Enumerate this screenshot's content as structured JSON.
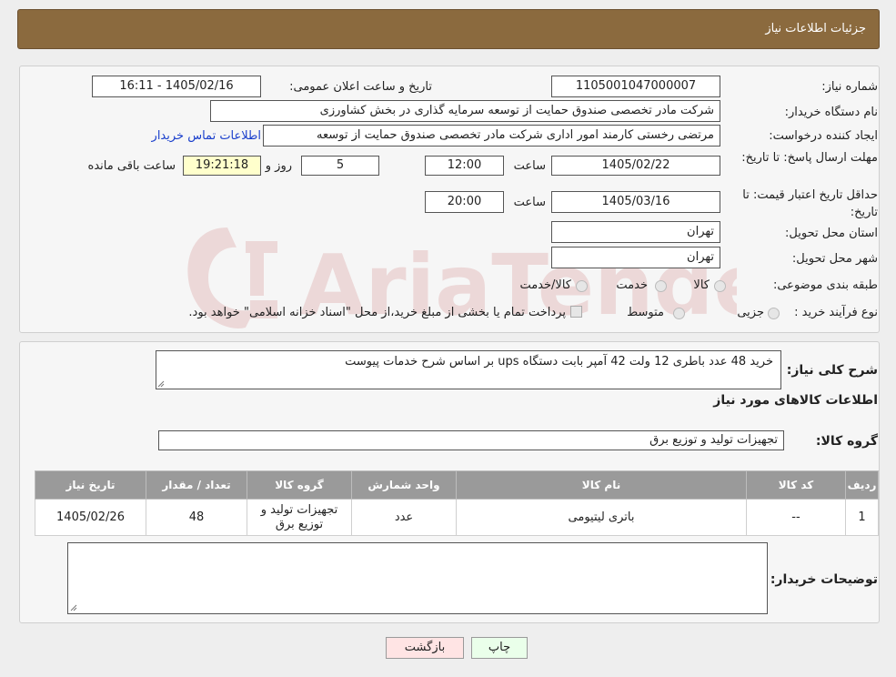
{
  "header": {
    "title": "جزئیات اطلاعات نیاز"
  },
  "form": {
    "need_number": {
      "label": "شماره نیاز:",
      "value": "1105001047000007"
    },
    "announce": {
      "label": "تاریخ و ساعت اعلان عمومی:",
      "value": "1405/02/16 - 16:11"
    },
    "buyer_org": {
      "label": "نام دستگاه خریدار:",
      "value": "شرکت مادر تخصصی صندوق حمایت از توسعه سرمایه گذاری در بخش کشاورزی"
    },
    "requester": {
      "label": "ایجاد کننده درخواست:",
      "value": "مرتضی رخستی کارمند امور اداری شرکت مادر تخصصی صندوق حمایت از توسعه",
      "link": "اطلاعات تماس خریدار"
    },
    "reply_deadline": {
      "label": "مهلت ارسال پاسخ: تا تاریخ:",
      "date": "1405/02/22",
      "time_label": "ساعت",
      "time": "12:00",
      "days": "5",
      "days_label": "روز و",
      "remaining": "19:21:18",
      "remaining_label": "ساعت باقی مانده"
    },
    "price_validity": {
      "label": "حداقل تاریخ اعتبار قیمت: تا تاریخ:",
      "date": "1405/03/16",
      "time_label": "ساعت",
      "time": "20:00"
    },
    "province": {
      "label": "استان محل تحویل:",
      "value": "تهران"
    },
    "city": {
      "label": "شهر محل تحویل:",
      "value": "تهران"
    },
    "category": {
      "label": "طبقه بندی موضوعی:",
      "options": [
        "کالا",
        "خدمت",
        "کالا/خدمت"
      ]
    },
    "process": {
      "label": "نوع فرآیند خرید :",
      "options": [
        "جزیی",
        "متوسط"
      ],
      "note": "پرداخت تمام یا بخشی از مبلغ خرید،از محل \"اسناد خزانه اسلامی\" خواهد بود."
    }
  },
  "summary": {
    "label": "شرح کلی نیاز:",
    "value": "خرید 48 عدد باطری 12 ولت 42 آمپر بابت دستگاه ups بر اساس شرح خدمات پیوست"
  },
  "goods_info_title": "اطلاعات کالاهای مورد نیاز",
  "goods_group": {
    "label": "گروه کالا:",
    "value": "تجهیزات تولید و توزیع برق"
  },
  "table": {
    "headers": [
      "ردیف",
      "کد کالا",
      "نام کالا",
      "واحد شمارش",
      "گروه کالا",
      "تعداد / مقدار",
      "تاریخ نیاز"
    ],
    "rows": [
      [
        "1",
        "--",
        "باتری لیتیومی",
        "عدد",
        "تجهیزات تولید و توزیع برق",
        "48",
        "1405/02/26"
      ]
    ]
  },
  "buyer_notes": {
    "label": "توضیحات خریدار:",
    "value": ""
  },
  "buttons": {
    "print": "چاپ",
    "back": "بازگشت"
  }
}
